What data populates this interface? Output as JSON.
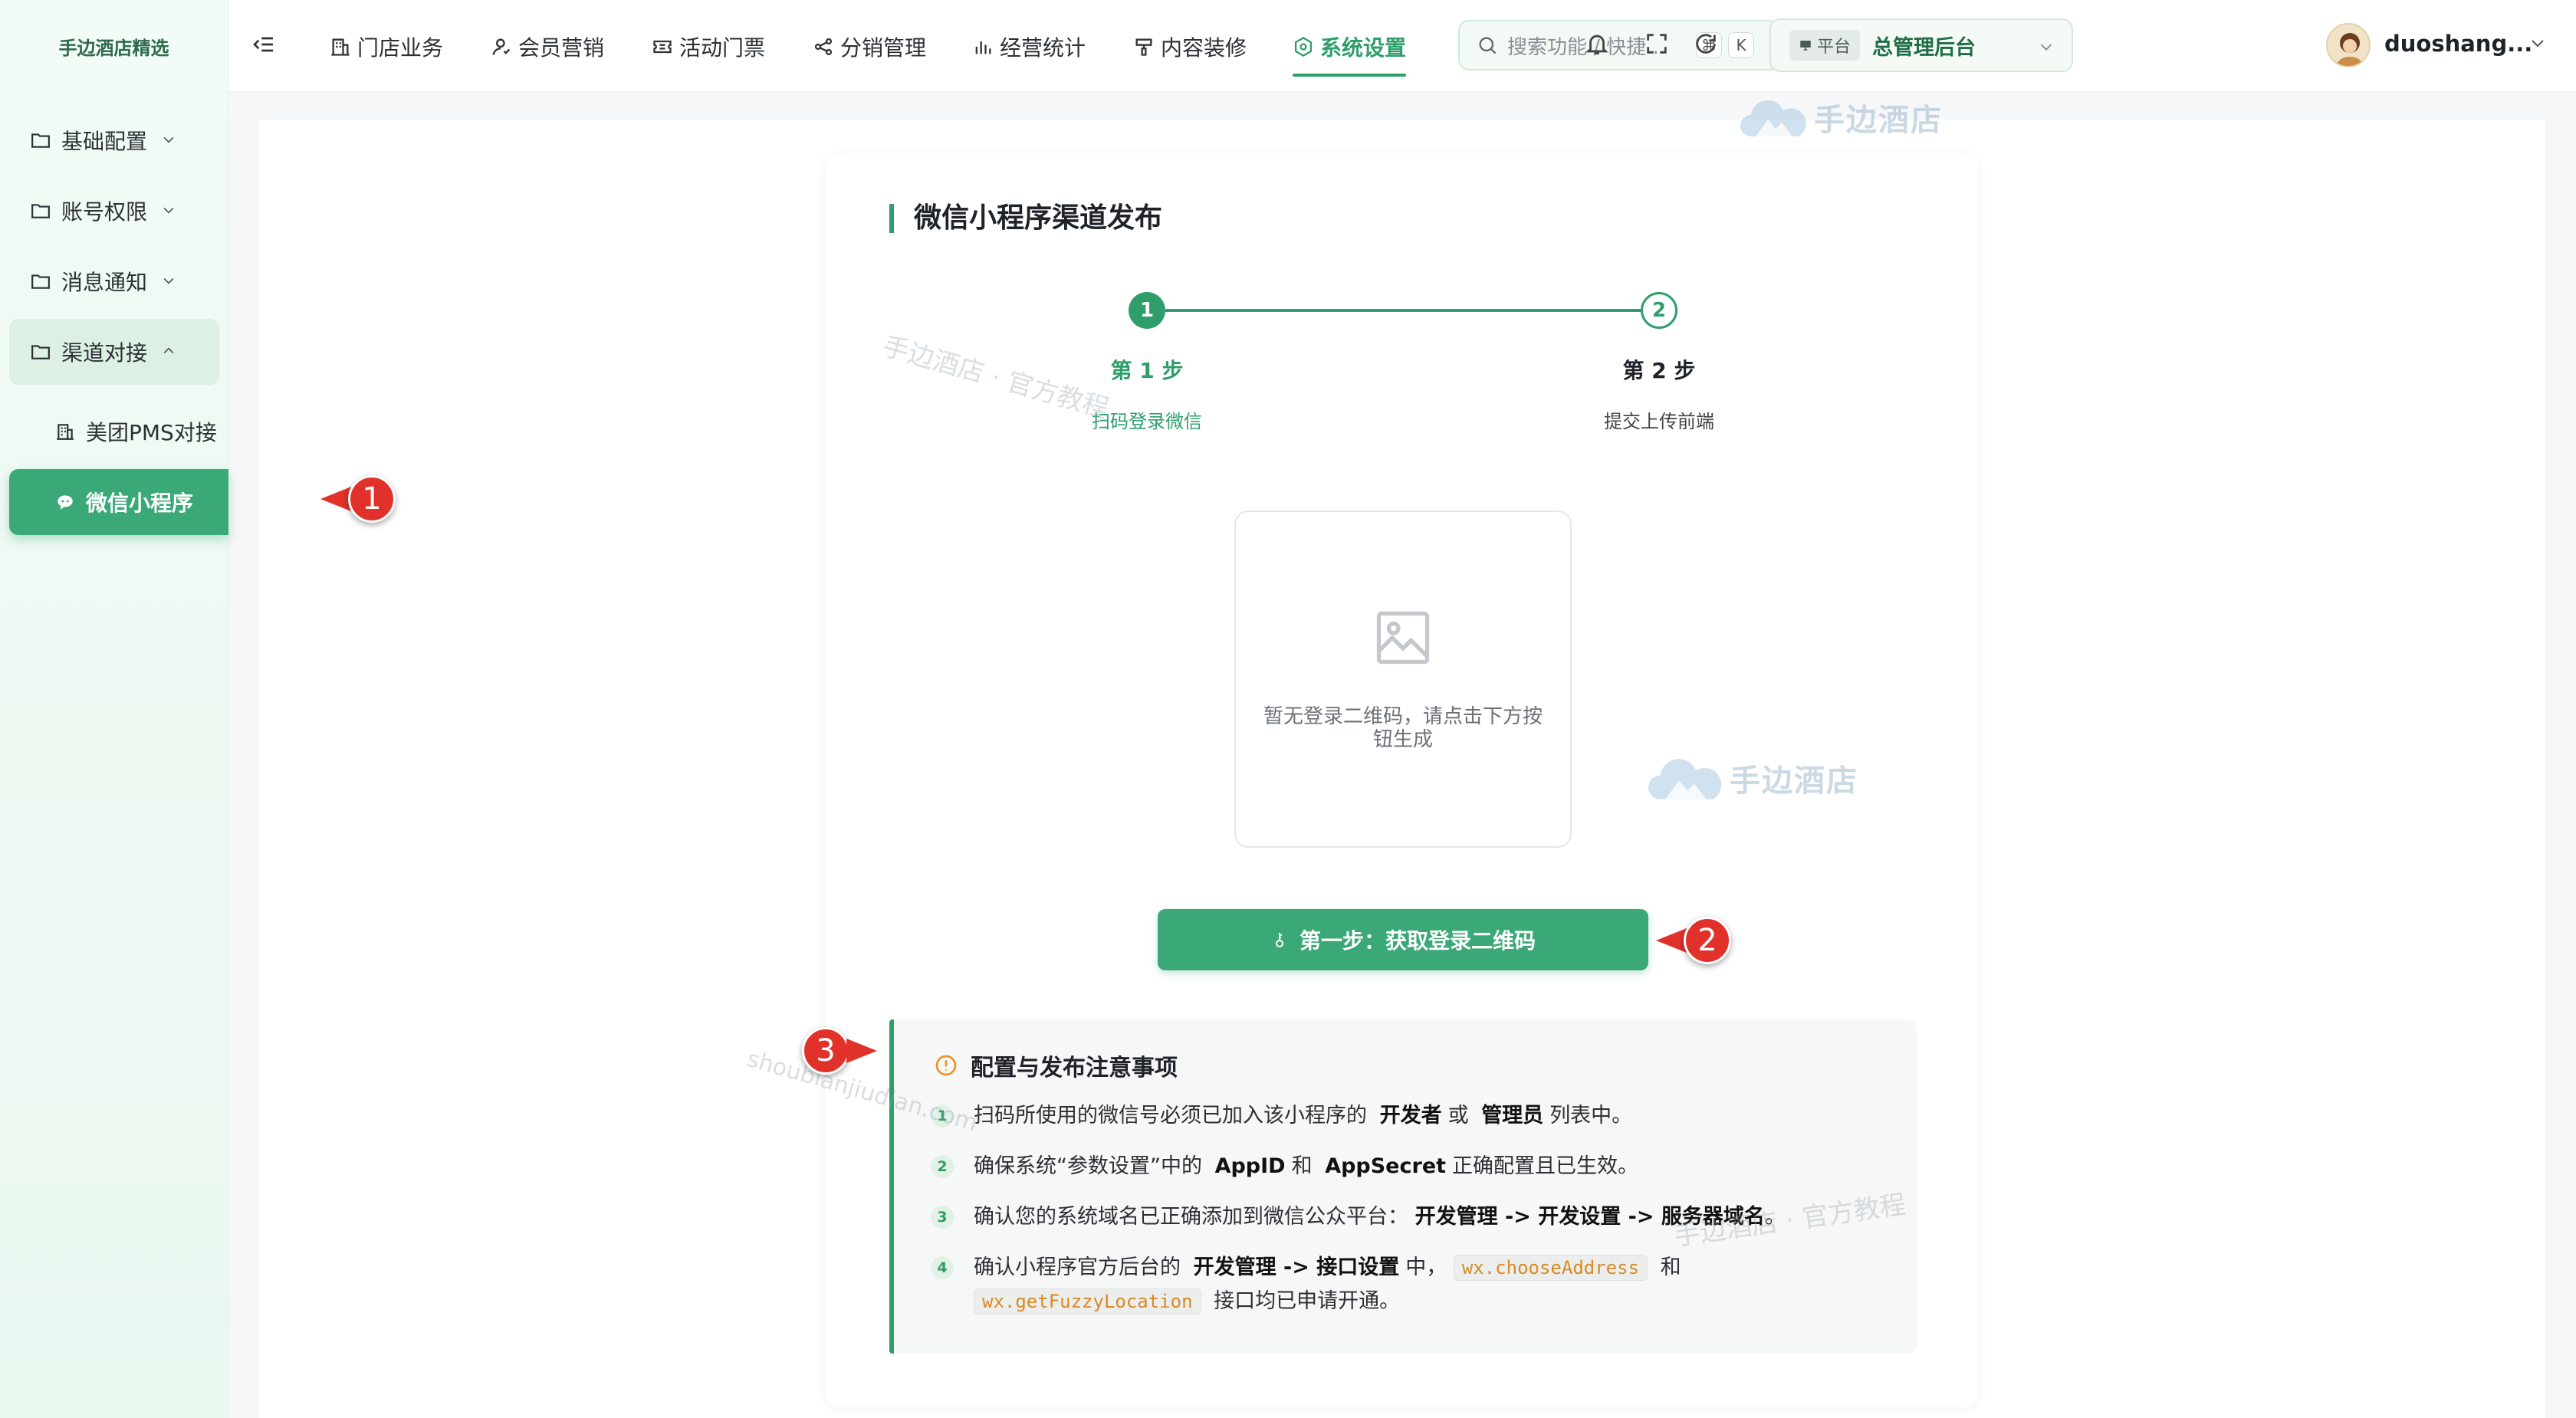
{
  "sidebar": {
    "brand": "手边酒店精选",
    "items": [
      {
        "label": "基础配置",
        "icon": "folder-icon"
      },
      {
        "label": "账号权限",
        "icon": "folder-icon"
      },
      {
        "label": "消息通知",
        "icon": "folder-icon"
      },
      {
        "label": "渠道对接",
        "icon": "folder-icon"
      }
    ],
    "sub_items": [
      {
        "label": "美团PMS对接",
        "icon": "building-icon"
      },
      {
        "label": "微信小程序",
        "icon": "wechat-icon"
      }
    ]
  },
  "topbar": {
    "nav": [
      {
        "label": "门店业务",
        "icon": "store-icon"
      },
      {
        "label": "会员营销",
        "icon": "member-icon"
      },
      {
        "label": "活动门票",
        "icon": "ticket-icon"
      },
      {
        "label": "分销管理",
        "icon": "share-icon"
      },
      {
        "label": "经营统计",
        "icon": "chart-icon"
      },
      {
        "label": "内容装修",
        "icon": "brush-icon"
      },
      {
        "label": "系统设置",
        "icon": "settings-icon"
      }
    ],
    "active_nav": "系统设置",
    "search_placeholder": "搜索功能 / 快捷...",
    "search_kbd_1": "⌘",
    "search_kbd_2": "K",
    "platform_tag": "平台",
    "platform_name": "总管理后台",
    "username": "duoshang..."
  },
  "main": {
    "card_title": "微信小程序渠道发布",
    "steps": [
      {
        "number": "1",
        "title": "第 1 步",
        "desc": "扫码登录微信",
        "status": "active"
      },
      {
        "number": "2",
        "title": "第 2 步",
        "desc": "提交上传前端",
        "status": "pending"
      }
    ],
    "qr_placeholder_text": "暂无登录二维码，请点击下方按钮生成",
    "primary_button": "第一步：获取登录二维码",
    "notice": {
      "title": "配置与发布注意事项",
      "items": [
        {
          "n": "1",
          "t1": "扫码所使用的微信号必须已加入该小程序的",
          "b1": "开发者",
          "t2": "或",
          "b2": "管理员",
          "t3": "列表中。"
        },
        {
          "n": "2",
          "t1": "确保系统“参数设置”中的",
          "b1": "AppID",
          "t2": "和",
          "b2": "AppSecret",
          "t3": "正确配置且已生效。"
        },
        {
          "n": "3",
          "t1": "确认您的系统域名已正确添加到微信公众平台：",
          "b1": "开发管理 -> 开发设置 -> 服务器域名",
          "t2": "。"
        },
        {
          "n": "4",
          "t1": "确认小程序官方后台的",
          "b1": "开发管理 -> 接口设置",
          "t2": "中，",
          "c1": "wx.chooseAddress",
          "t3": "和",
          "c2": "wx.getFuzzyLocation",
          "t4": "接口均已申请开通。"
        }
      ]
    }
  },
  "watermarks": {
    "logo_text": "手边酒店",
    "text_1": "手边酒店 · 官方教程",
    "text_2": "shoubianjiudian.com",
    "text_3": "手边酒店 · 官方教程"
  },
  "callouts": [
    "1",
    "2",
    "3"
  ],
  "colors": {
    "primary": "#3aa877",
    "accent_text": "#2f9e6b",
    "callout_red": "#e0322b"
  }
}
